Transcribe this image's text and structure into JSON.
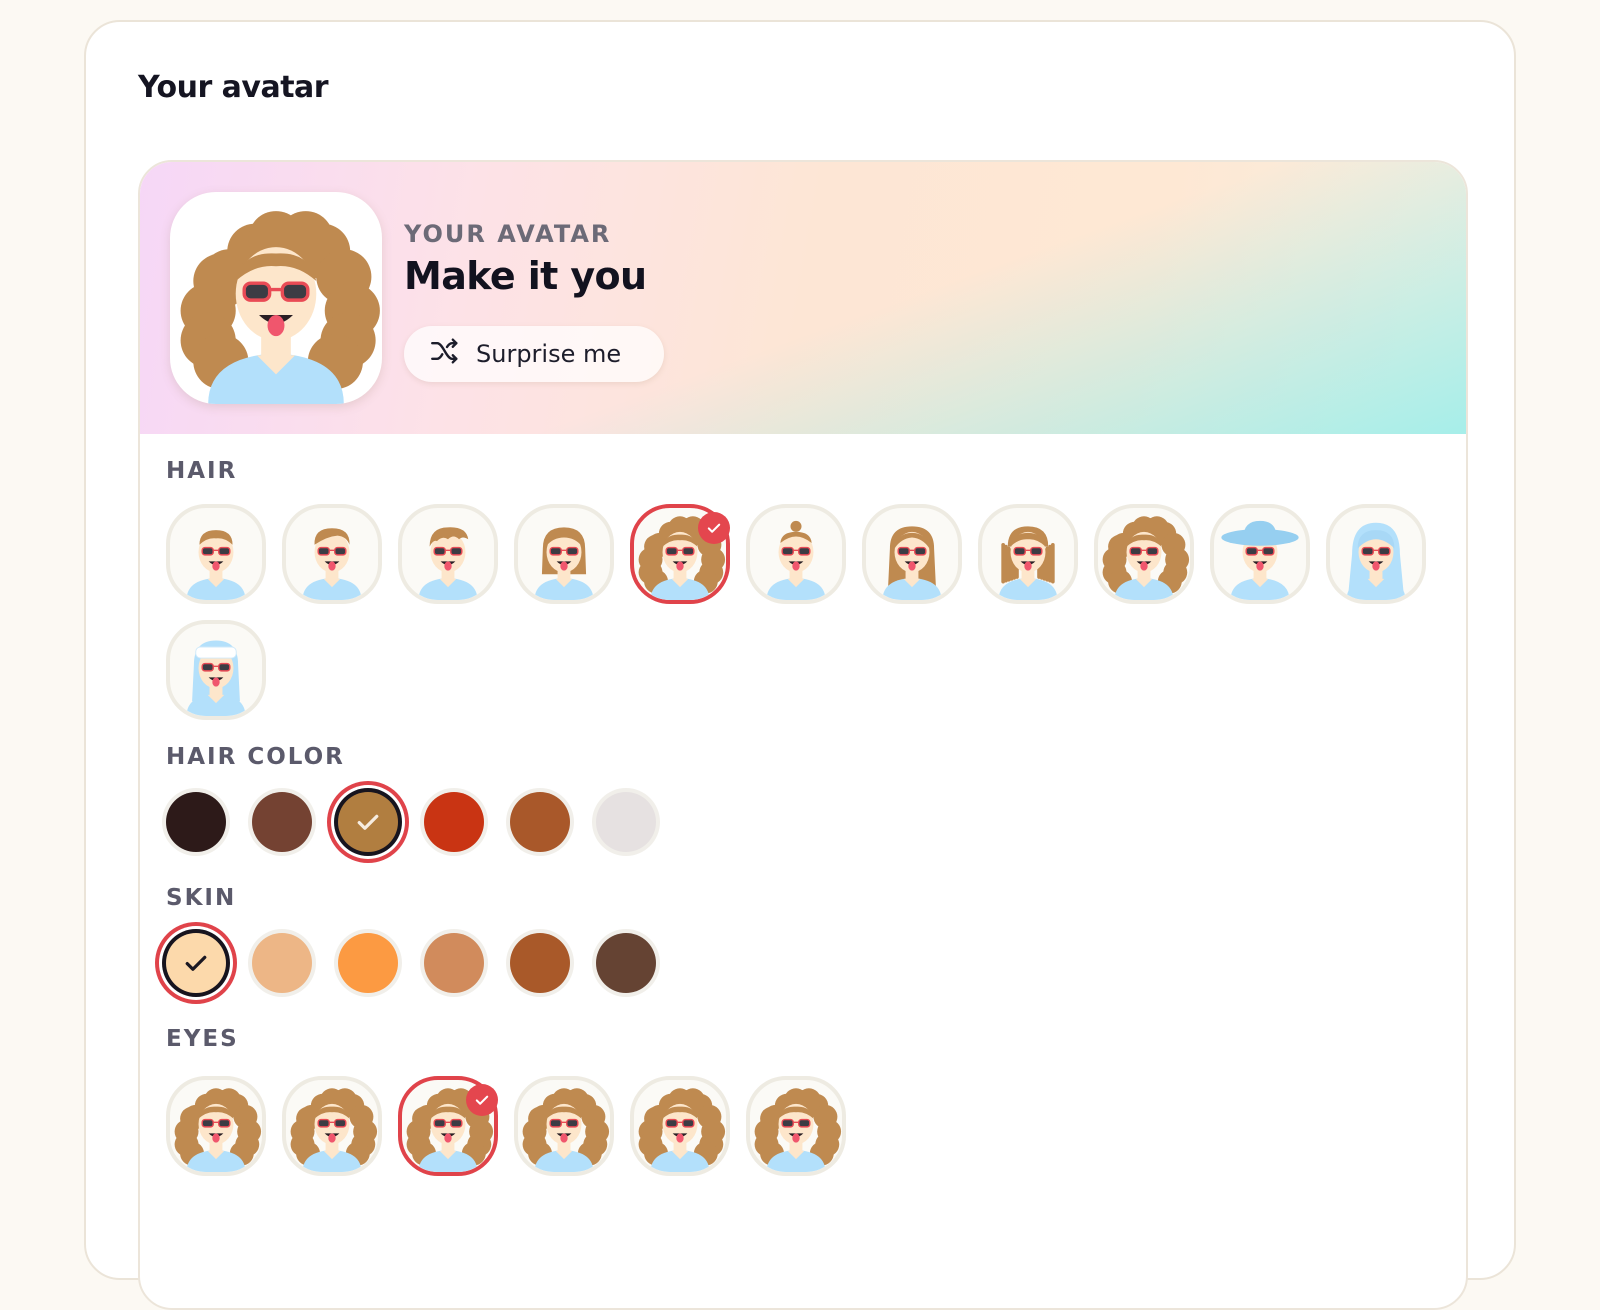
{
  "page": {
    "title": "Your avatar"
  },
  "hero": {
    "kicker": "YOUR AVATAR",
    "title": "Make it you",
    "surprise_label": "Surprise me",
    "surprise_icon": "shuffle-icon"
  },
  "sections": {
    "hair": {
      "label": "HAIR",
      "options": [
        "short-crop",
        "side-part",
        "messy-fringe",
        "bob",
        "curly",
        "top-bun",
        "long-straight",
        "dreadlocks",
        "afro-curly",
        "wide-hat",
        "hijab",
        "headscarf"
      ],
      "selected_index": 4
    },
    "hair_color": {
      "label": "HAIR COLOR",
      "swatches": [
        "#2d1a19",
        "#744232",
        "#b17e40",
        "#c93413",
        "#a9582a",
        "#e6e1e1"
      ],
      "selected_index": 2,
      "check_color": "#f6ece0"
    },
    "skin": {
      "label": "SKIN",
      "swatches": [
        "#fcd9ab",
        "#edb686",
        "#fc9a42",
        "#d18b5c",
        "#a95929",
        "#654333"
      ],
      "selected_index": 0,
      "check_color": "#1b1822"
    },
    "eyes": {
      "label": "EYES",
      "options": [
        "eyes-1",
        "eyes-2",
        "eyes-3",
        "eyes-4",
        "eyes-5",
        "eyes-6"
      ],
      "selected_index": 2
    }
  },
  "colors": {
    "accent": "#e0434a",
    "hair": "#bf8a50",
    "skin": "#fde6cb",
    "shirt": "#b3e0fb",
    "glasses": "#e94b55",
    "hat_blue": "#96cff0"
  }
}
